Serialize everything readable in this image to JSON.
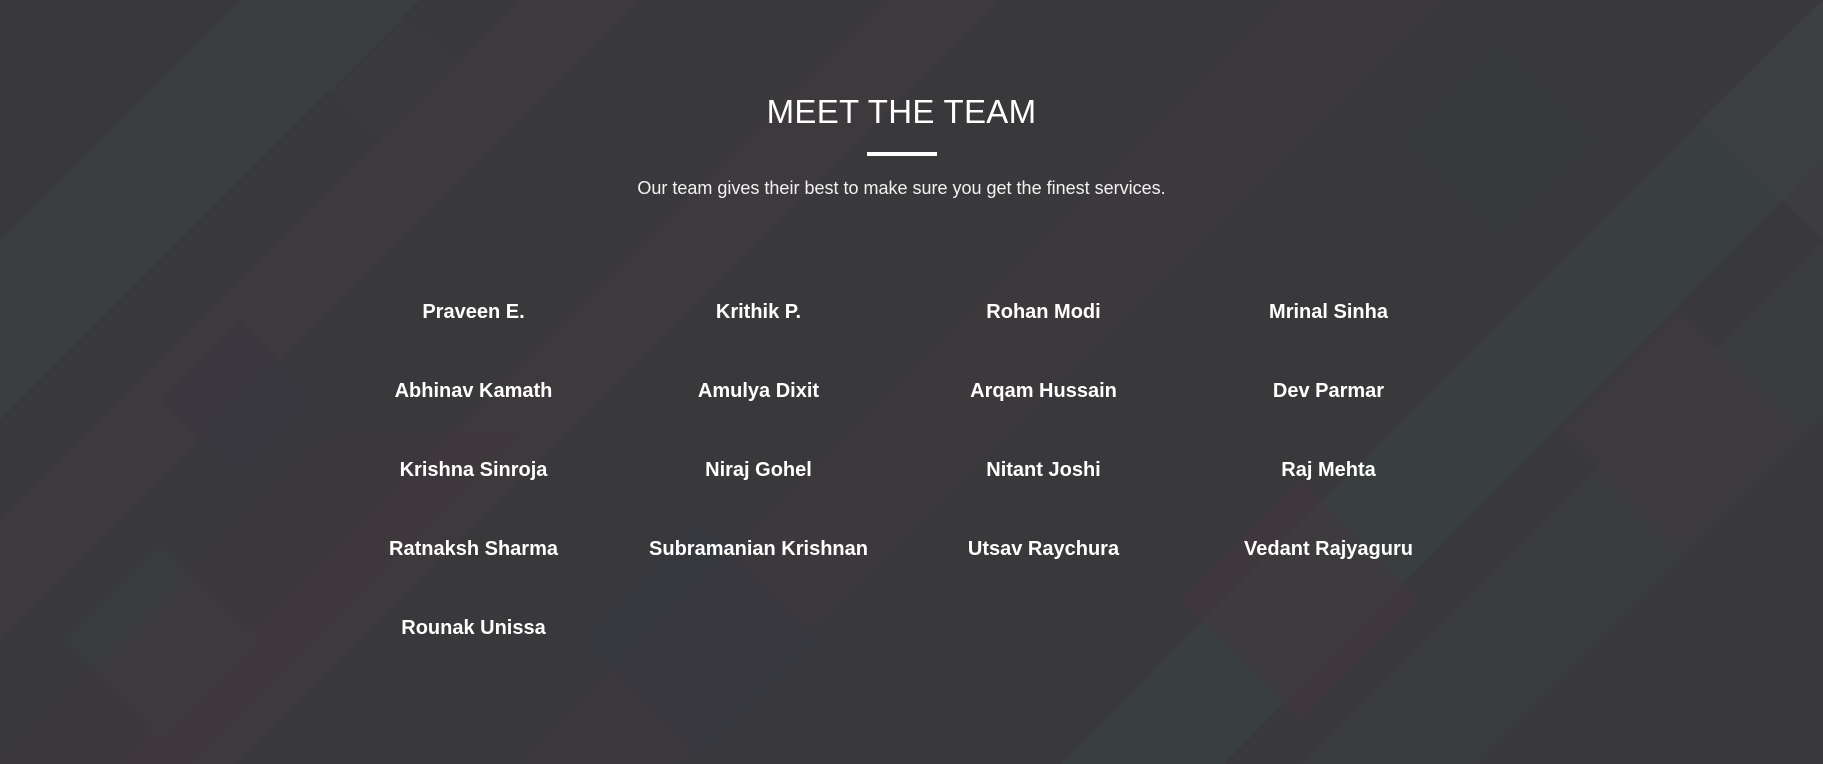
{
  "section": {
    "title": "MEET THE TEAM",
    "subtitle": "Our team gives their best to make sure you get the finest services."
  },
  "team": [
    "Praveen E.",
    "Krithik P.",
    "Rohan Modi",
    "Mrinal Sinha",
    "Abhinav Kamath",
    "Amulya Dixit",
    "Arqam Hussain",
    "Dev Parmar",
    "Krishna Sinroja",
    "Niraj Gohel",
    "Nitant Joshi",
    "Raj Mehta",
    "Ratnaksh Sharma",
    "Subramanian Krishnan",
    "Utsav Raychura",
    "Vedant Rajyaguru",
    "Rounak Unissa"
  ],
  "colors": {
    "background": "#3c3b3e",
    "text": "#ffffff"
  }
}
